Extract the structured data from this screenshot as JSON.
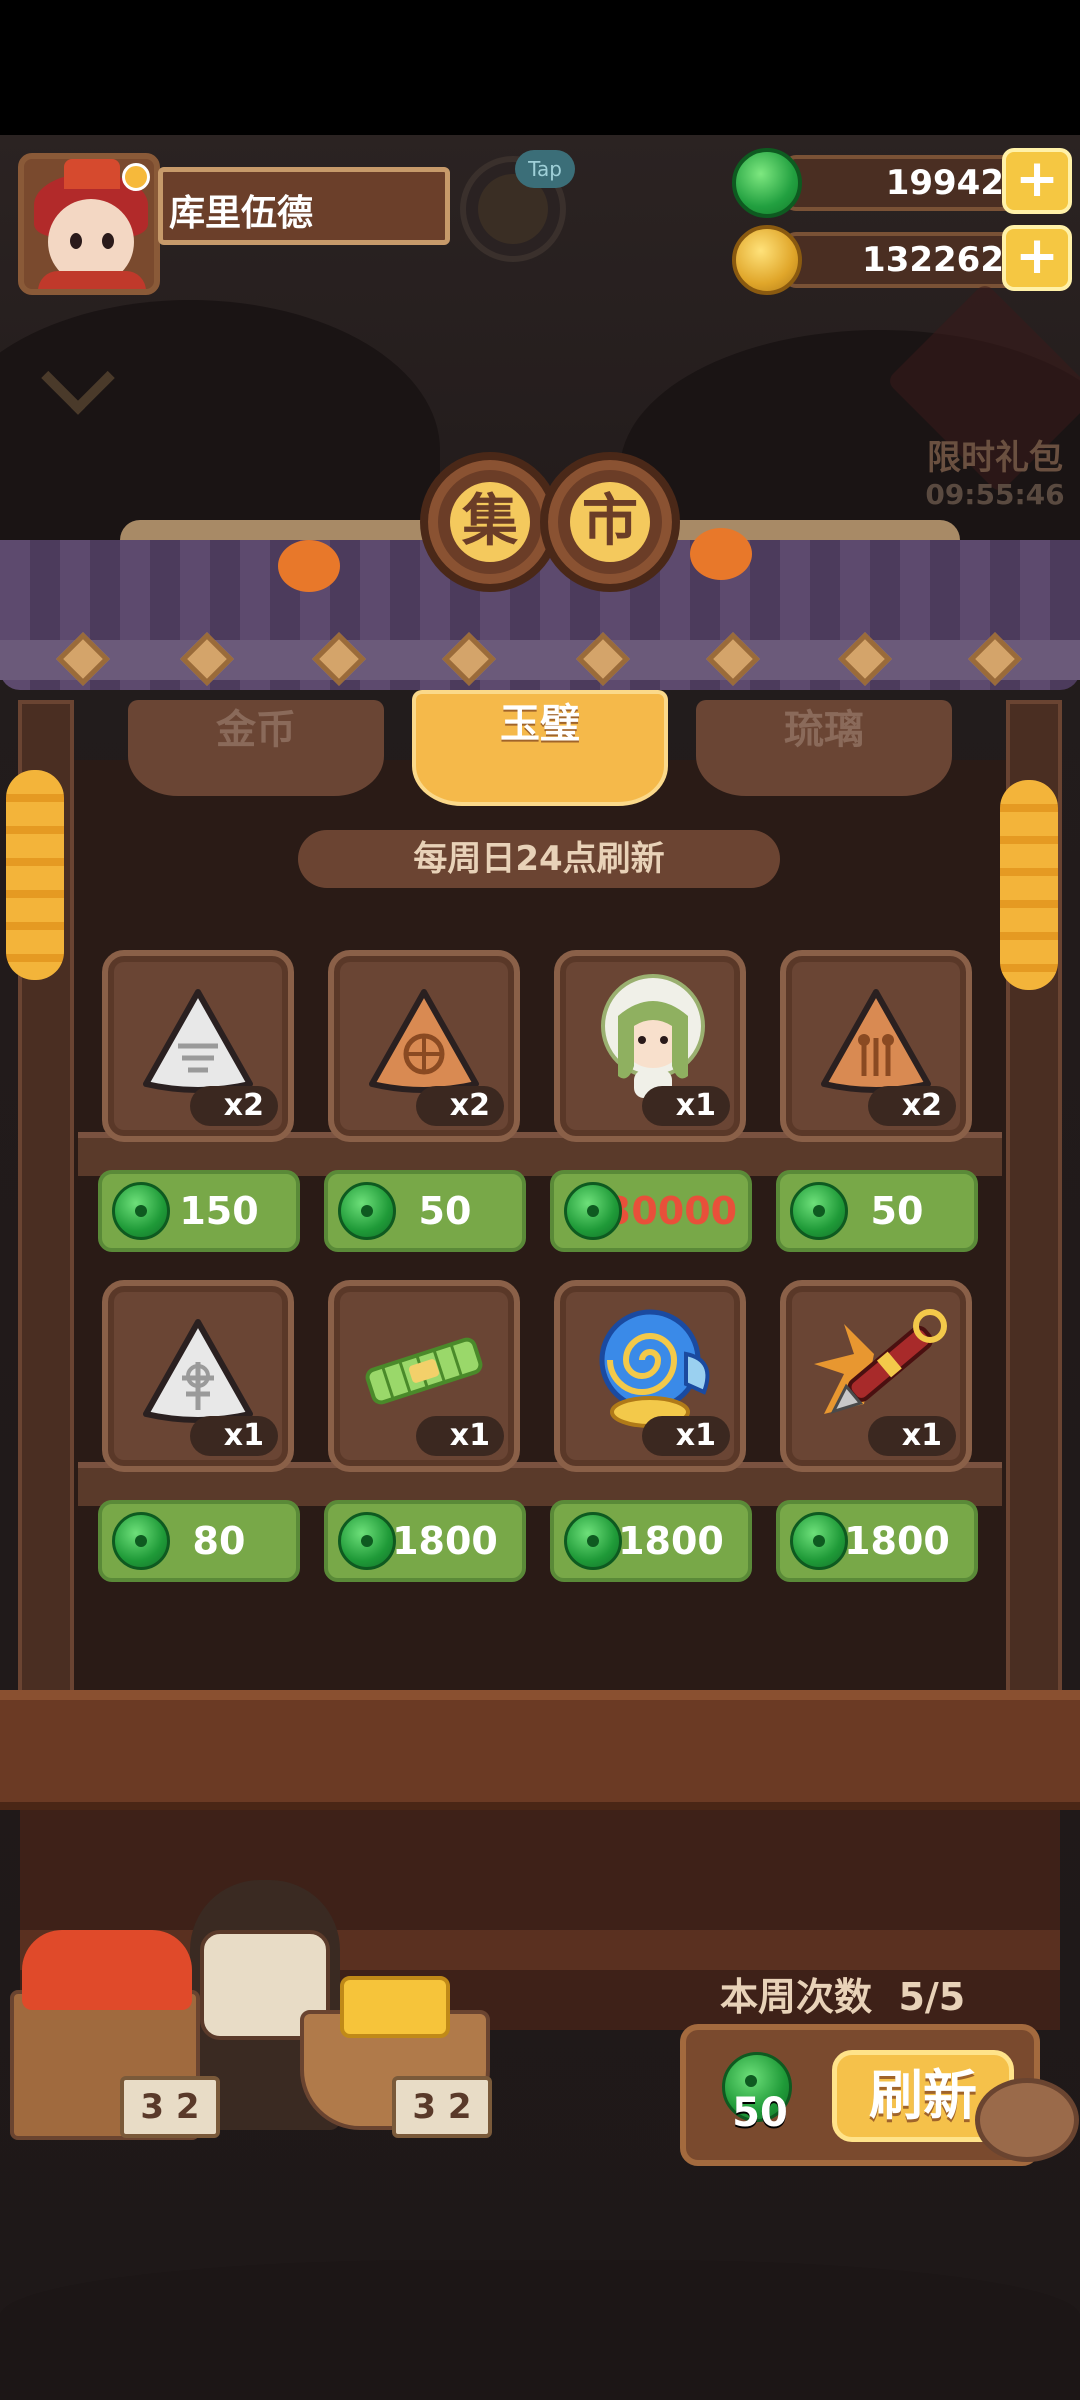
{
  "player": {
    "name": "库里伍德"
  },
  "tap_badge": "Tap",
  "currencies": {
    "jade": {
      "icon": "jade-coin-icon",
      "value": "19942"
    },
    "gold": {
      "icon": "gold-coin-icon",
      "value": "132262"
    },
    "plus_label": "+"
  },
  "gift": {
    "label": "限时礼包",
    "timer": "09:55:46"
  },
  "title": {
    "char1": "集",
    "char2": "市"
  },
  "tabs": [
    {
      "label": "金币",
      "active": false
    },
    {
      "label": "玉璧",
      "active": true
    },
    {
      "label": "琉璃",
      "active": false
    }
  ],
  "notice": "每周日24点刷新",
  "items": [
    {
      "icon": "white-triangle-token-icon",
      "qty": "x2",
      "price": "150",
      "price_color": "#ffffff"
    },
    {
      "icon": "orange-triangle-token-icon",
      "qty": "x2",
      "price": "50",
      "price_color": "#ffffff"
    },
    {
      "icon": "character-girl-icon",
      "qty": "x1",
      "price": "30000",
      "price_color": "#e8503a"
    },
    {
      "icon": "orange-triangle-token-icon",
      "qty": "x2",
      "price": "50",
      "price_color": "#ffffff"
    },
    {
      "icon": "white-triangle-token-icon",
      "qty": "x1",
      "price": "80",
      "price_color": "#ffffff"
    },
    {
      "icon": "jade-ruler-icon",
      "qty": "x1",
      "price": "1800",
      "price_color": "#ffffff"
    },
    {
      "icon": "blue-swirl-shell-icon",
      "qty": "x1",
      "price": "1800",
      "price_color": "#ffffff"
    },
    {
      "icon": "brush-pen-icon",
      "qty": "x1",
      "price": "1800",
      "price_color": "#ffffff"
    }
  ],
  "weekly": {
    "label": "本周次数",
    "count": "5/5"
  },
  "refresh": {
    "cost": "50",
    "label": "刷新"
  },
  "stall_signs": [
    "3 2",
    "3 2"
  ],
  "colors": {
    "price_bg": "#78a848",
    "accent": "#f5c14a",
    "wood": "#6b3a24"
  }
}
